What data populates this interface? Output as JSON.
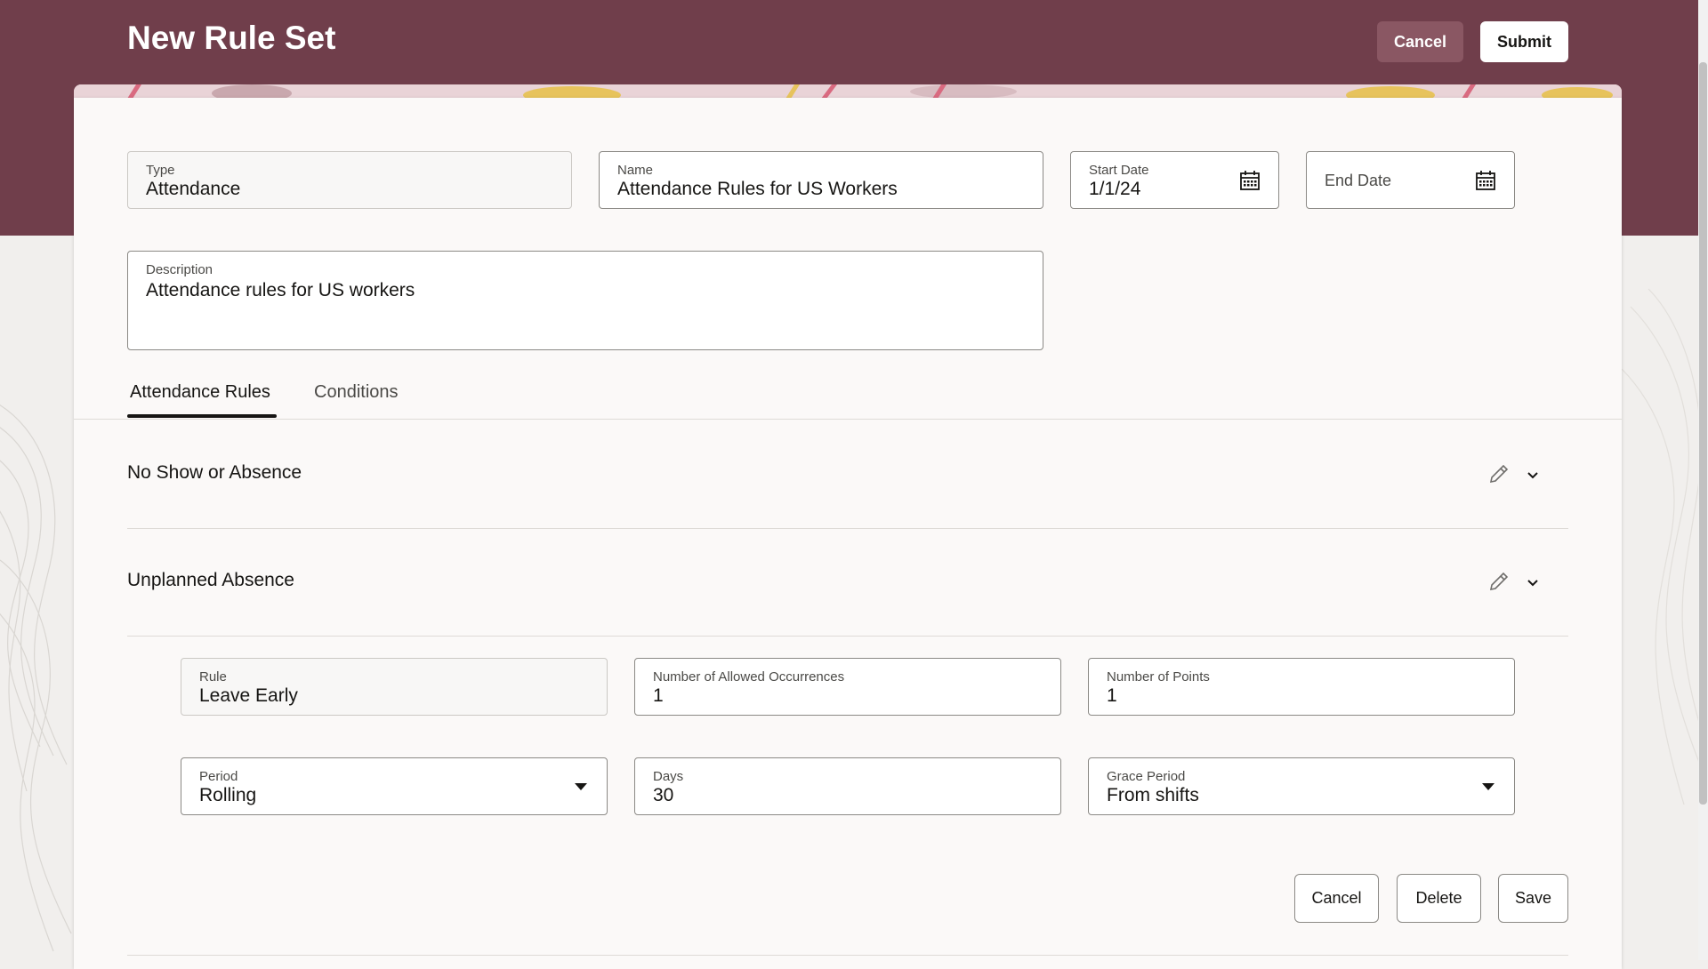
{
  "header": {
    "title": "New Rule Set",
    "cancel_label": "Cancel",
    "submit_label": "Submit",
    "banner_color": "#703e4b"
  },
  "form": {
    "type": {
      "label": "Type",
      "value": "Attendance"
    },
    "name": {
      "label": "Name",
      "value": "Attendance Rules for US Workers"
    },
    "start_date": {
      "label": "Start Date",
      "value": "1/1/24",
      "icon": "calendar-icon"
    },
    "end_date": {
      "label": "End Date",
      "value": "",
      "icon": "calendar-icon"
    },
    "description": {
      "label": "Description",
      "value": "Attendance rules for US workers"
    }
  },
  "tabs": [
    {
      "label": "Attendance Rules",
      "active": true
    },
    {
      "label": "Conditions",
      "active": false
    }
  ],
  "rules": [
    {
      "title": "No Show or Absence",
      "expanded": false
    },
    {
      "title": "Unplanned Absence",
      "expanded": true
    }
  ],
  "rule_detail": {
    "rule": {
      "label": "Rule",
      "value": "Leave Early"
    },
    "allowed_occurrences": {
      "label": "Number of Allowed Occurrences",
      "value": "1"
    },
    "points": {
      "label": "Number of Points",
      "value": "1"
    },
    "period": {
      "label": "Period",
      "value": "Rolling"
    },
    "days": {
      "label": "Days",
      "value": "30"
    },
    "grace_period": {
      "label": "Grace Period",
      "value": "From shifts"
    }
  },
  "actions": {
    "cancel_label": "Cancel",
    "delete_label": "Delete",
    "save_label": "Save"
  }
}
